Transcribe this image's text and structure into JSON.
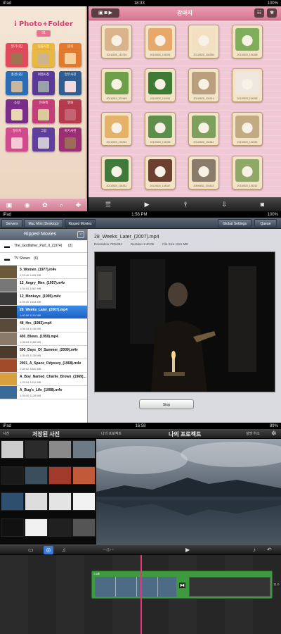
{
  "s1": {
    "status": {
      "left": "iPad",
      "time": "18:33",
      "right": "100%"
    },
    "app_title": "i Photo+Folder",
    "app_sub": "31",
    "folders": [
      {
        "label": "일기사진",
        "color": "#e04a5a"
      },
      {
        "label": "동물사진",
        "color": "#e8b840"
      },
      {
        "label": "음식",
        "color": "#e27a2f"
      },
      {
        "label": "풍경사진",
        "color": "#2a6db5"
      },
      {
        "label": "여행사진",
        "color": "#5a3a96"
      },
      {
        "label": "업무사진",
        "color": "#2f5c91"
      },
      {
        "label": "쇼핑",
        "color": "#7a2c8a"
      },
      {
        "label": "만화책",
        "color": "#c23f7a"
      },
      {
        "label": "영화",
        "color": "#b53a4e"
      },
      {
        "label": "강아지",
        "color": "#d24a8e"
      },
      {
        "label": "그림",
        "color": "#5f3f9b"
      },
      {
        "label": "아기사진",
        "color": "#9b2f74"
      }
    ],
    "header_title": "강아지",
    "photos": [
      "20110520_113716",
      "20110520_104251",
      "20110520_104256",
      "20110520_104258",
      "20110514_074445",
      "20110520_104311",
      "20110520_104314",
      "20110520_104318",
      "20110520_104324",
      "20110520_104335",
      "20110520_104342",
      "20110520_104345",
      "20110520_104331",
      "20110520_104347",
      "20090811_203423",
      "20110520_105212"
    ],
    "toolbar": [
      "list-icon",
      "play-icon",
      "share-icon",
      "download-icon",
      "camera-icon"
    ]
  },
  "s2": {
    "status": {
      "left": "iPad",
      "time": "1:58 PM",
      "right": "100%"
    },
    "crumbs": [
      "Servers",
      "Mac Mini (Desktop)",
      "Ripped Movies"
    ],
    "buttons": {
      "settings": "Global Settings",
      "queue": "Queue"
    },
    "list_title": "Ripped Movies",
    "folders": [
      {
        "name": "The_Godfather_Part_II_(1974)",
        "count": "(2)"
      },
      {
        "name": "TV Shows",
        "count": "(6)"
      }
    ],
    "movies": [
      {
        "title": "3_Women_(1977).m4v",
        "meta": "2:03:46   1406 MB"
      },
      {
        "title": "12_Angry_Men_(1957).m4v",
        "meta": "1:34:54   1082 MB"
      },
      {
        "title": "12_Monkeys_(1995).m4v",
        "meta": "2:09:30   1543 MB"
      },
      {
        "title": "28_Weeks_Later_(2007).mp4",
        "meta": "1:40:06   1191 MB"
      },
      {
        "title": "48_Hrs_(1982).mp4",
        "meta": "1:36:34   1146 MB"
      },
      {
        "title": "400_Blows_(1959).mp4",
        "meta": "1:38:54   1186 MB"
      },
      {
        "title": "500_Days_Of_Summer_(2009).m4v",
        "meta": "1:35:05   1130 MB"
      },
      {
        "title": "2001_A_Space_Odyssey_(1968).m4v",
        "meta": "2:28:52   1840 MB"
      },
      {
        "title": "A_Boy_Named_Charlie_Brown_(1969)...",
        "meta": "1:25:54   1015 MB"
      },
      {
        "title": "A_Bug's_Life_(1998).m4v",
        "meta": "1:35:00   1128 MB"
      }
    ],
    "selected_index": 3,
    "detail": {
      "title": "28_Weeks_Later_(2007).mp4",
      "resolution_label": "Resolution",
      "resolution": "720x394",
      "duration_label": "Duration",
      "duration": "1:40:06",
      "size_label": "File Size",
      "size": "1191 MB",
      "stop": "Stop"
    }
  },
  "s3": {
    "status": {
      "left": "iPad",
      "time": "16:58",
      "right": "89%"
    },
    "left_btn": "사진",
    "left_title": "저장된 사진",
    "right_btn": "나의 프로젝트",
    "center_title": "나의 프로젝트",
    "settings_btn": "설명 하소",
    "clip_label": "7.6초",
    "time_right": "11.0"
  }
}
